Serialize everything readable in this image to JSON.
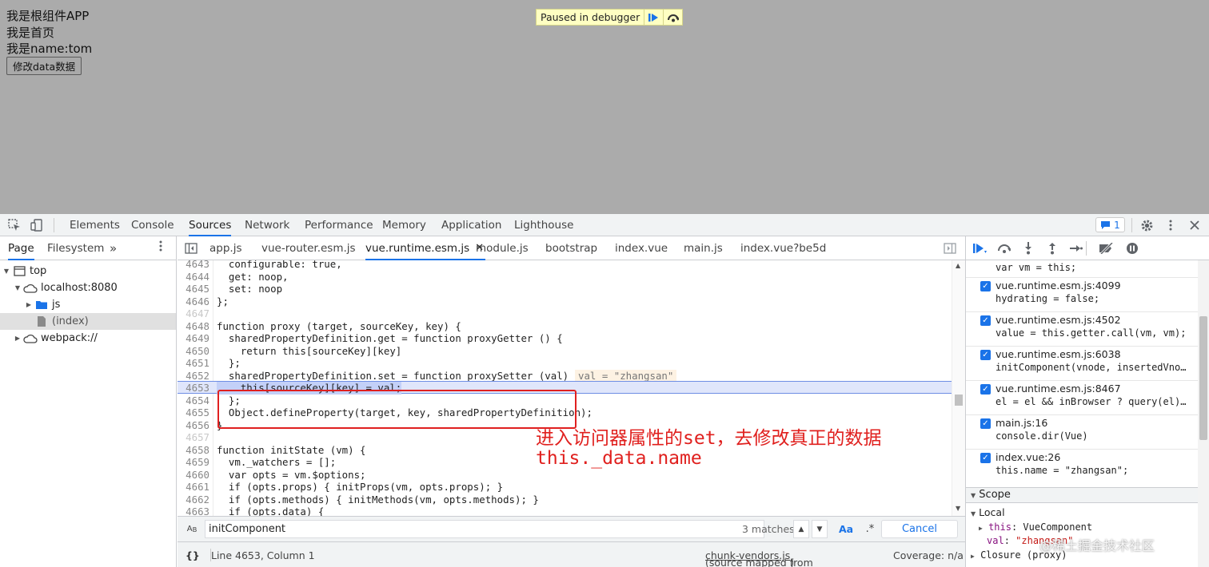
{
  "page": {
    "lines": [
      "我是根组件APP",
      "我是首页",
      "我是name:tom"
    ],
    "button_label": "修改data数据",
    "paused_banner": "Paused in debugger"
  },
  "devtools": {
    "main_tabs": [
      "Elements",
      "Console",
      "Sources",
      "Network",
      "Performance",
      "Memory",
      "Application",
      "Lighthouse"
    ],
    "active_main_tab": "Sources",
    "issues_count": "1",
    "navigator_tabs": [
      "Page",
      "Filesystem"
    ],
    "more_tabs": "»",
    "tree": [
      {
        "label": "top",
        "icon": "frame-icon"
      },
      {
        "label": "localhost:8080",
        "icon": "cloud-icon"
      },
      {
        "label": "js",
        "icon": "folder-icon"
      },
      {
        "label": "(index)",
        "icon": "file-icon"
      },
      {
        "label": "webpack://",
        "icon": "cloud-icon"
      }
    ],
    "file_tabs": [
      "app.js",
      "vue-router.esm.js",
      "vue.runtime.esm.js",
      "module.js",
      "bootstrap",
      "index.vue",
      "main.js",
      "index.vue?be5d"
    ],
    "active_file_tab": "vue.runtime.esm.js",
    "code_lines": [
      {
        "n": "4643",
        "code": "  configurable: true,"
      },
      {
        "n": "4644",
        "code": "  get: noop,"
      },
      {
        "n": "4645",
        "code": "  set: noop"
      },
      {
        "n": "4646",
        "code": "};"
      },
      {
        "n": "4647",
        "code": ""
      },
      {
        "n": "4648",
        "code": "function proxy (target, sourceKey, key) {"
      },
      {
        "n": "4649",
        "code": "  sharedPropertyDefinition.get = function proxyGetter () {"
      },
      {
        "n": "4650",
        "code": "    return this[sourceKey][key]"
      },
      {
        "n": "4651",
        "code": "  };"
      },
      {
        "n": "4652",
        "code": "  sharedPropertyDefinition.set = function proxySetter (val) {"
      },
      {
        "n": "4653",
        "code": "    this[sourceKey][key] = val;"
      },
      {
        "n": "4654",
        "code": "  };"
      },
      {
        "n": "4655",
        "code": "  Object.defineProperty(target, key, sharedPropertyDefinition);"
      },
      {
        "n": "4656",
        "code": "}"
      },
      {
        "n": "4657",
        "code": ""
      },
      {
        "n": "4658",
        "code": "function initState (vm) {"
      },
      {
        "n": "4659",
        "code": "  vm._watchers = [];"
      },
      {
        "n": "4660",
        "code": "  var opts = vm.$options;"
      },
      {
        "n": "4661",
        "code": "  if (opts.props) { initProps(vm, opts.props); }"
      },
      {
        "n": "4662",
        "code": "  if (opts.methods) { initMethods(vm, opts.methods); }"
      },
      {
        "n": "4663",
        "code": "  if (opts.data) {"
      }
    ],
    "inline_value_hint": "val = \"zhangsan\"",
    "annotation": {
      "line1": "进入访问器属性的set，去修改真正的数据",
      "line2": "this._data.name"
    },
    "search": {
      "query": "initComponent",
      "matches": "3 matches",
      "case_label": "Aa",
      "regex_label": ".*",
      "cancel_label": "Cancel"
    },
    "status": {
      "braces": "{}",
      "position": "Line 4653, Column 1",
      "source_mapped_prefix": "(source mapped from ",
      "source_mapped_file": "chunk-vendors.js",
      "source_mapped_suffix": ")",
      "coverage": "Coverage: n/a"
    },
    "call_stack": [
      {
        "code": "var vm = this;"
      },
      {
        "location": "vue.runtime.esm.js:4099",
        "code": "hydrating = false;"
      },
      {
        "location": "vue.runtime.esm.js:4502",
        "code": "value = this.getter.call(vm, vm);"
      },
      {
        "location": "vue.runtime.esm.js:6038",
        "code": "initComponent(vnode, insertedVno…"
      },
      {
        "location": "vue.runtime.esm.js:8467",
        "code": "el = el && inBrowser ? query(el)…"
      },
      {
        "location": "main.js:16",
        "code": "console.dir(Vue)"
      },
      {
        "location": "index.vue:26",
        "code": "this.name = \"zhangsan\";"
      }
    ],
    "scope": {
      "title": "Scope",
      "local": "Local",
      "this_key": "this",
      "this_value": "VueComponent",
      "val_key": "val",
      "val_value": "\"zhangsan\"",
      "closure": "Closure (proxy)"
    },
    "watermark": "@稀土掘金技术社区"
  }
}
